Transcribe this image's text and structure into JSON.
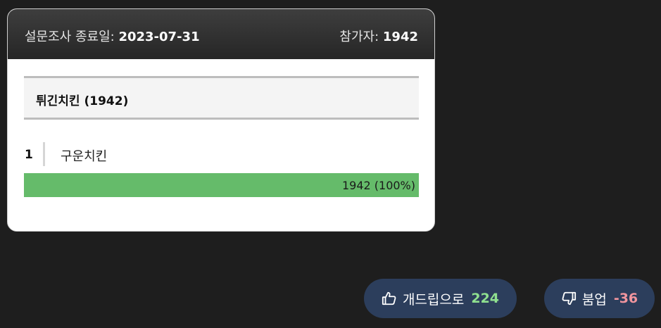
{
  "poll": {
    "end_date_label": "설문조사 종료일:",
    "end_date": "2023-07-31",
    "participants_label": "참가자:",
    "participants": "1942",
    "question": {
      "title": "튀긴치킨",
      "count": "(1942)"
    },
    "options": [
      {
        "rank": "1",
        "label": "구운치킨",
        "result_text": "1942 (100%)",
        "fraction": 1.0
      }
    ]
  },
  "votes": {
    "up": {
      "icon": "thumbs-up-icon",
      "label": "개드립으로",
      "count": "224"
    },
    "down": {
      "icon": "thumbs-down-icon",
      "label": "붐업",
      "count": "-36"
    }
  },
  "colors": {
    "background": "#1e1e1e",
    "bar_fill": "#65bb6a",
    "vote_button": "#2c3e5c",
    "up_count": "#8fe08f",
    "down_count": "#f1959e"
  }
}
